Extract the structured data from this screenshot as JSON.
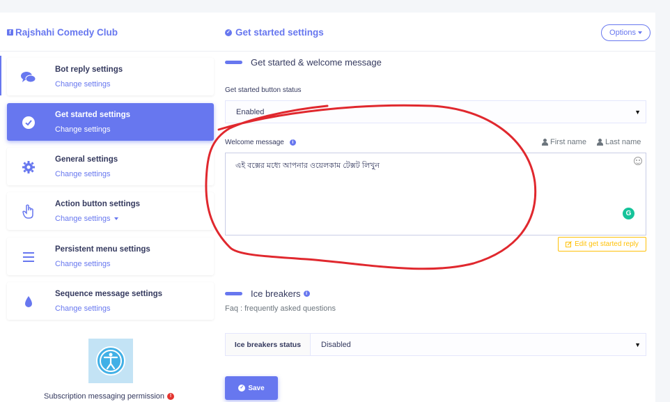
{
  "sidebar": {
    "page_name": "Rajshahi Comedy Club",
    "items": [
      {
        "title": "Bot reply settings",
        "sub": "Change settings",
        "icon": "chat-icon"
      },
      {
        "title": "Get started settings",
        "sub": "Change settings",
        "icon": "check-circle-icon"
      },
      {
        "title": "General settings",
        "sub": "Change settings",
        "icon": "gear-icon"
      },
      {
        "title": "Action button settings",
        "sub": "Change settings",
        "icon": "hand-pointer-icon"
      },
      {
        "title": "Persistent menu settings",
        "sub": "Change settings",
        "icon": "bars-icon"
      },
      {
        "title": "Sequence message settings",
        "sub": "Change settings",
        "icon": "tint-icon"
      }
    ],
    "subscription_label": "Subscription messaging permission",
    "subscription_badge": "!"
  },
  "header": {
    "title": "Get started settings",
    "options_label": "Options"
  },
  "welcome": {
    "section_title": "Get started & welcome message",
    "status_label": "Get started button status",
    "status_value": "Enabled",
    "message_label": "Welcome message",
    "first_name": "First name",
    "last_name": "Last name",
    "message_text": "এই বক্সের মধ্যে আপনার ওয়েলকাম টেক্সট লিখুন",
    "edit_button": "Edit get started reply"
  },
  "ice": {
    "section_title": "Ice breakers",
    "faq_text": "Faq : frequently asked questions",
    "status_label": "Ice breakers status",
    "status_value": "Disabled"
  },
  "save_label": "Save",
  "colors": {
    "accent": "#6777ef",
    "warning": "#ffc107",
    "annotation_red": "#e0282e"
  }
}
